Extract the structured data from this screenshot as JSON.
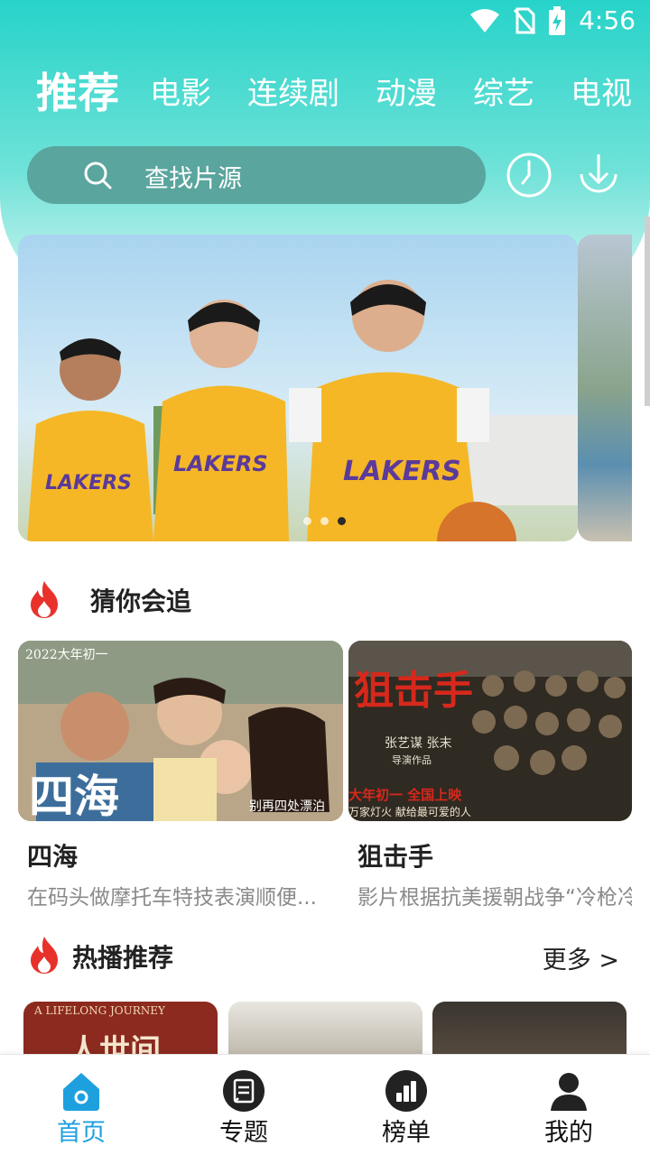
{
  "status_bar": {
    "time": "4:56",
    "icons": [
      "wifi-icon",
      "no-sim-icon",
      "battery-charging-icon"
    ]
  },
  "tabs": [
    {
      "label": "推荐",
      "active": true
    },
    {
      "label": "电影",
      "active": false
    },
    {
      "label": "连续剧",
      "active": false
    },
    {
      "label": "动漫",
      "active": false
    },
    {
      "label": "综艺",
      "active": false
    },
    {
      "label": "电视",
      "active": false
    }
  ],
  "search": {
    "placeholder": "查找片源"
  },
  "header_icons": [
    "history-clock-icon",
    "download-icon"
  ],
  "banner": {
    "jersey_text": "LAKERS",
    "slide_count": 3,
    "active_slide": 3
  },
  "section_guess": {
    "title": "猜你会追"
  },
  "cards": [
    {
      "title": "四海",
      "desc": "在码头做摩托车特技表演顺便...",
      "poster_title": "四海",
      "poster_tag": "2022大年初一",
      "poster_slogan": "别再四处漂泊"
    },
    {
      "title": "狙击手",
      "desc": "影片根据抗美援朝战争“冷枪冷炮运动”",
      "poster_title": "狙击手",
      "poster_credit": "张艺谋 张末",
      "poster_credit_sub": "导演作品",
      "poster_date": "大年初一 全国上映",
      "poster_slogan": "万家灯火  献给最可爱的人"
    }
  ],
  "section_hot": {
    "title": "热播推荐",
    "more_label": "更多 >"
  },
  "thumbnails": [
    {
      "title": "人世间",
      "caption": "A LIFELONG JOURNEY"
    },
    {
      "title": ""
    },
    {
      "title": ""
    }
  ],
  "bottom_nav": [
    {
      "label": "首页",
      "icon": "home-icon",
      "active": true
    },
    {
      "label": "专题",
      "icon": "topics-icon",
      "active": false
    },
    {
      "label": "榜单",
      "icon": "ranking-icon",
      "active": false
    },
    {
      "label": "我的",
      "icon": "profile-icon",
      "active": false
    }
  ],
  "colors": {
    "accent_teal": "#27d3c9",
    "search_bg": "#5aa59d",
    "active_nav": "#1ea0df",
    "fire": "#e8312a"
  }
}
